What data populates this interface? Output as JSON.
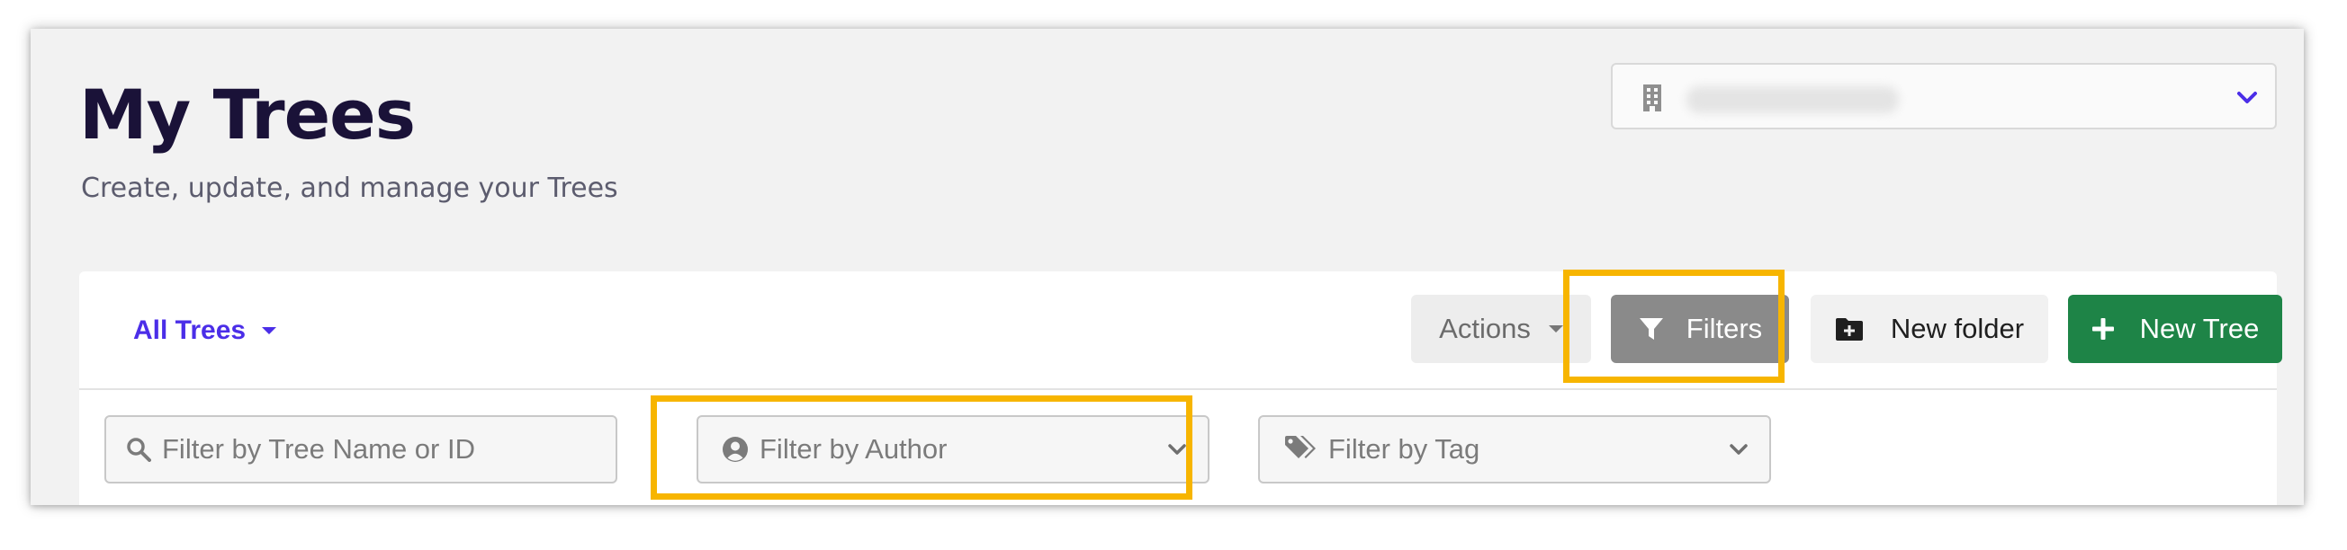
{
  "header": {
    "title": "My Trees",
    "subtitle": "Create, update, and manage your Trees"
  },
  "org_selector": {
    "icon": "building-icon",
    "value": "",
    "chevron_icon": "chevron-down-icon"
  },
  "toolbar": {
    "view_dropdown_label": "All Trees",
    "actions_label": "Actions",
    "filters_label": "Filters",
    "new_folder_label": "New folder",
    "new_tree_label": "New Tree"
  },
  "filters": {
    "name_placeholder": "Filter by Tree Name or ID",
    "author_placeholder": "Filter by Author",
    "tag_placeholder": "Filter by Tag"
  },
  "colors": {
    "accent": "#4b2ee8",
    "primary_button": "#1e8447",
    "filters_button": "#8a8a8a",
    "highlight": "#f7b500",
    "title": "#1a1238"
  }
}
